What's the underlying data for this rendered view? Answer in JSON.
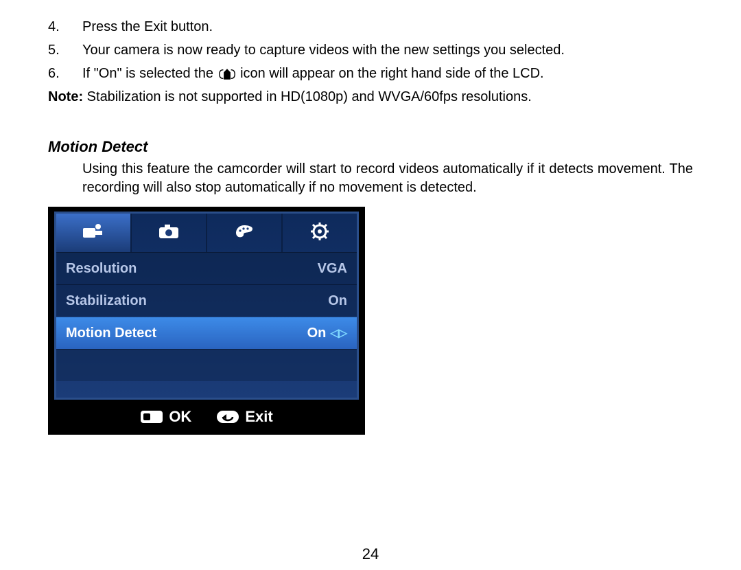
{
  "steps": [
    {
      "num": "4.",
      "text": "Press the Exit button."
    },
    {
      "num": "5.",
      "text": "Your camera is now ready to capture videos with the new settings you selected."
    },
    {
      "num": "6.",
      "pre": "If \"On\" is selected the ",
      "post": " icon will appear on the right hand side of the LCD."
    }
  ],
  "note_label": "Note:",
  "note_text": " Stabilization is not supported in HD(1080p) and WVGA/60fps resolutions.",
  "section_title": "Motion Detect",
  "body": "Using this feature the camcorder will start to record videos automatically if it detects movement. The recording will also stop automatically if no movement is detected.",
  "menu": {
    "rows": [
      {
        "label": "Resolution",
        "value": "VGA"
      },
      {
        "label": "Stabilization",
        "value": "On"
      },
      {
        "label": "Motion Detect",
        "value": "On"
      }
    ],
    "footer": {
      "ok": "OK",
      "exit": "Exit"
    }
  },
  "page_number": "24"
}
